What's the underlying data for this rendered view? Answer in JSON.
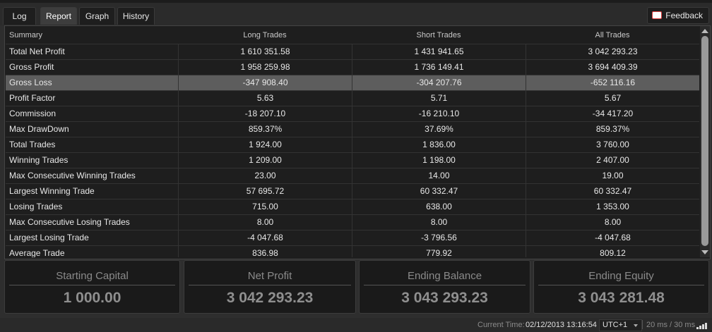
{
  "tabs": [
    {
      "label": "Log",
      "active": false
    },
    {
      "label": "Report",
      "active": true
    },
    {
      "label": "Graph",
      "active": false
    },
    {
      "label": "History",
      "active": false
    }
  ],
  "feedback": {
    "label": "Feedback",
    "icon": "feedback-icon"
  },
  "table": {
    "headers": [
      "Summary",
      "Long Trades",
      "Short Trades",
      "All Trades"
    ],
    "selected_row": 2,
    "rows": [
      {
        "label": "Total Net Profit",
        "long": "1 610 351.58",
        "short": "1 431 941.65",
        "all": "3 042 293.23"
      },
      {
        "label": "Gross Profit",
        "long": "1 958 259.98",
        "short": "1 736 149.41",
        "all": "3 694 409.39"
      },
      {
        "label": "Gross Loss",
        "long": "-347 908.40",
        "short": "-304 207.76",
        "all": "-652 116.16"
      },
      {
        "label": "Profit Factor",
        "long": "5.63",
        "short": "5.71",
        "all": "5.67"
      },
      {
        "label": "Commission",
        "long": "-18 207.10",
        "short": "-16 210.10",
        "all": "-34 417.20"
      },
      {
        "label": "Max DrawDown",
        "long": "859.37%",
        "short": "37.69%",
        "all": "859.37%"
      },
      {
        "label": "Total Trades",
        "long": "1 924.00",
        "short": "1 836.00",
        "all": "3 760.00"
      },
      {
        "label": "Winning Trades",
        "long": "1 209.00",
        "short": "1 198.00",
        "all": "2 407.00"
      },
      {
        "label": "Max Consecutive Winning Trades",
        "long": "23.00",
        "short": "14.00",
        "all": "19.00"
      },
      {
        "label": "Largest Winning Trade",
        "long": "57 695.72",
        "short": "60 332.47",
        "all": "60 332.47"
      },
      {
        "label": "Losing Trades",
        "long": "715.00",
        "short": "638.00",
        "all": "1 353.00"
      },
      {
        "label": "Max Consecutive Losing Trades",
        "long": "8.00",
        "short": "8.00",
        "all": "8.00"
      },
      {
        "label": "Largest Losing Trade",
        "long": "-4 047.68",
        "short": "-3 796.56",
        "all": "-4 047.68"
      },
      {
        "label": "Average Trade",
        "long": "836.98",
        "short": "779.92",
        "all": "809.12"
      }
    ]
  },
  "cards": [
    {
      "label": "Starting Capital",
      "value": "1 000.00"
    },
    {
      "label": "Net Profit",
      "value": "3 042 293.23"
    },
    {
      "label": "Ending Balance",
      "value": "3 043 293.23"
    },
    {
      "label": "Ending Equity",
      "value": "3 043 281.48"
    }
  ],
  "status": {
    "current_time_label": "Current Time:",
    "current_time": "02/12/2013 13:16:54",
    "timezone": "UTC+1",
    "latency": "20 ms / 30 ms",
    "signal_icon": "signal-strength-icon"
  }
}
